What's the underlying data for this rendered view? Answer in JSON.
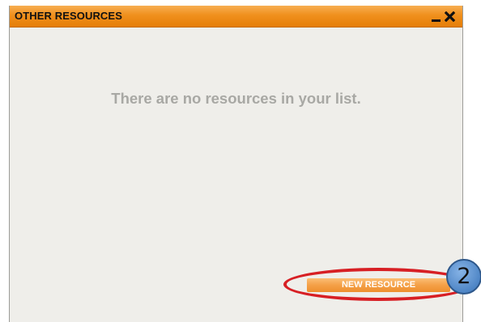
{
  "window": {
    "title": "OTHER RESOURCES",
    "minimize_icon": "minimize-icon",
    "close_icon": "close-icon"
  },
  "main": {
    "empty_message": "There are no resources in your list."
  },
  "actions": {
    "new_resource_label": "NEW RESOURCE"
  },
  "annotation": {
    "step_number": "2",
    "highlight_color": "#d71f24",
    "badge_color": "#4f86c6"
  },
  "colors": {
    "titlebar": "#f0901d",
    "panel_background": "#efeeea",
    "button": "#f4a047"
  }
}
